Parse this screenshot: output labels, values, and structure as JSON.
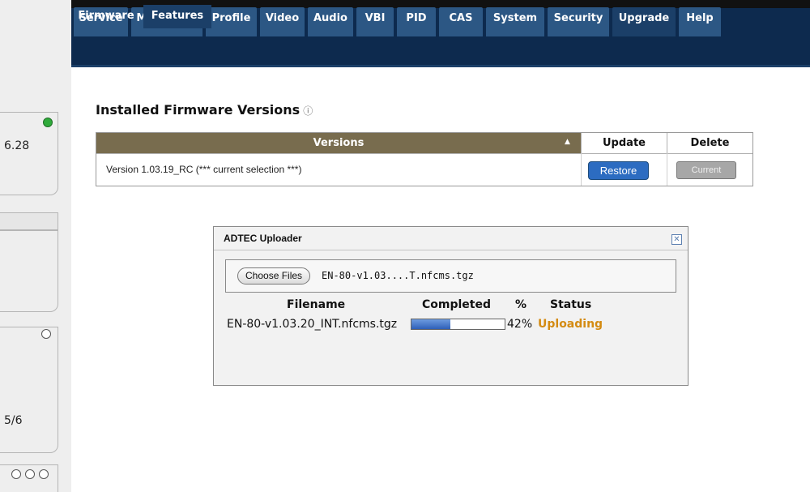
{
  "nav": {
    "tabs": [
      {
        "label": "Service",
        "active": false
      },
      {
        "label": "Modulator",
        "active": false
      },
      {
        "label": "Profile",
        "active": false
      },
      {
        "label": "Video",
        "active": false
      },
      {
        "label": "Audio",
        "active": false
      },
      {
        "label": "VBI",
        "active": false
      },
      {
        "label": "PID",
        "active": false
      },
      {
        "label": "CAS",
        "active": false
      },
      {
        "label": "System",
        "active": false
      },
      {
        "label": "Security",
        "active": false
      },
      {
        "label": "Upgrade",
        "active": true
      },
      {
        "label": "Help",
        "active": false
      }
    ],
    "subtabs": [
      {
        "label": "Firmware",
        "active": false
      },
      {
        "label": "Features",
        "active": true
      }
    ]
  },
  "sidebar": {
    "card1_text": "6.28",
    "card3_text": "5/6"
  },
  "firmware": {
    "heading": "Installed Firmware Versions",
    "help_icon": "?",
    "headers": {
      "versions": "Versions",
      "update": "Update",
      "delete": "Delete"
    },
    "rows": [
      {
        "version": "Version 1.03.19_RC (*** current selection ***)",
        "update_label": "Restore",
        "delete_label": "Current"
      }
    ]
  },
  "uploader": {
    "title": "ADTEC Uploader",
    "choose_label": "Choose Files",
    "chosen_file": "EN-80-v1.03....T.nfcms.tgz",
    "columns": {
      "filename": "Filename",
      "completed": "Completed",
      "percent": "%",
      "status": "Status"
    },
    "file": {
      "filename": "EN-80-v1.03.20_INT.nfcms.tgz",
      "progress": 0.42,
      "percent": "42%",
      "status": "Uploading"
    }
  },
  "colors": {
    "nav_bg": "#0d2a4e",
    "tab_bg": "#2c5784",
    "header_bg": "#786c4e",
    "restore_blue": "#2c6cc1",
    "uploading_orange": "#d48b12",
    "status_green": "#2faa3a"
  }
}
